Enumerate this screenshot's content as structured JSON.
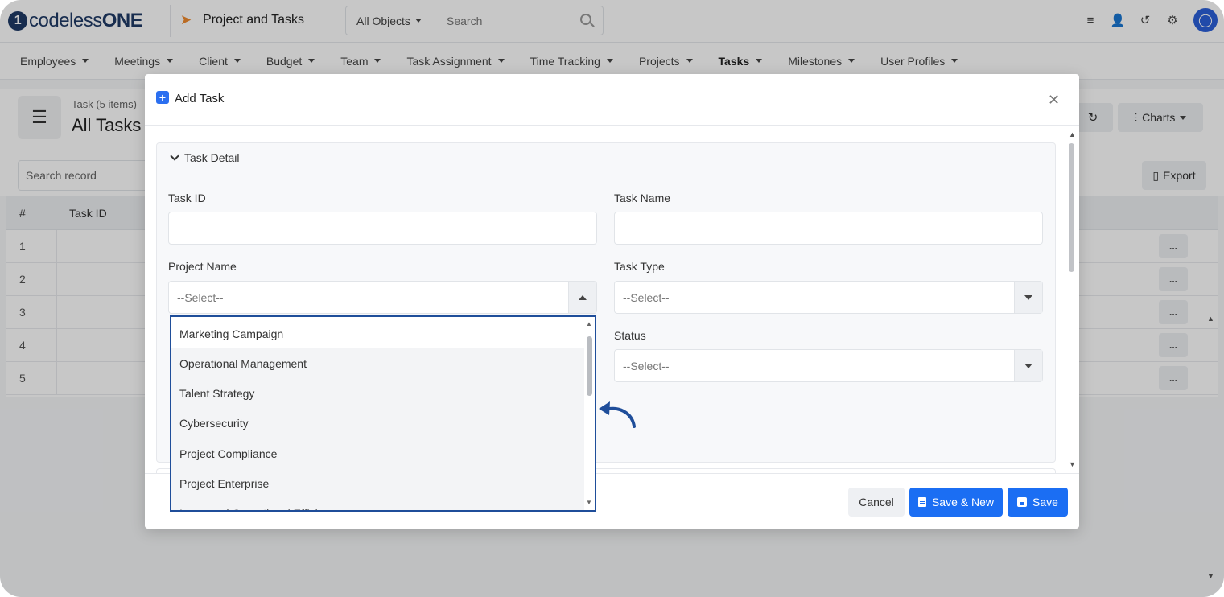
{
  "topbar": {
    "logo_text": "codeless",
    "logo_bold": "ONE",
    "app_title": "Project and Tasks",
    "objects_select": "All Objects",
    "search_placeholder": "Search",
    "icons": [
      "database-icon",
      "add-user-icon",
      "history-icon",
      "gear-icon",
      "user-avatar-icon"
    ]
  },
  "nav": {
    "items": [
      "Employees",
      "Meetings",
      "Client",
      "Budget",
      "Team",
      "Task Assignment",
      "Time Tracking",
      "Projects",
      "Tasks",
      "Milestones",
      "User Profiles"
    ],
    "active": "Tasks"
  },
  "page": {
    "breadcrumb": "Task (5 items)",
    "title": "All Tasks",
    "charts_label": "Charts",
    "search_placeholder": "Search record",
    "export_label": "Export",
    "columns": [
      "#",
      "Task ID"
    ],
    "rows": [
      "1",
      "2",
      "3",
      "4",
      "5"
    ],
    "row_menu": "..."
  },
  "modal": {
    "title": "Add Task",
    "section_title": "Task Detail",
    "fields": {
      "task_id_label": "Task ID",
      "task_name_label": "Task Name",
      "project_name_label": "Project Name",
      "project_name_value": "--Select--",
      "task_type_label": "Task Type",
      "task_type_value": "--Select--",
      "status_label": "Status",
      "status_value": "--Select--"
    },
    "dropdown_options": [
      "Marketing Campaign",
      "Operational Management",
      "Talent Strategy",
      "Cybersecurity",
      "Project Compliance",
      "Project Enterprise",
      "Increased Operational Efficiency"
    ],
    "highlighted_option": "Operational Management",
    "buttons": {
      "cancel": "Cancel",
      "save_new": "Save & New",
      "save": "Save"
    }
  },
  "colors": {
    "primary": "#1b6ef3",
    "logo": "#1f3a66",
    "dropdown_border": "#1f4e9a",
    "annotation_arrow": "#1f4e9a",
    "accent_plane": "#ef8a2e"
  }
}
